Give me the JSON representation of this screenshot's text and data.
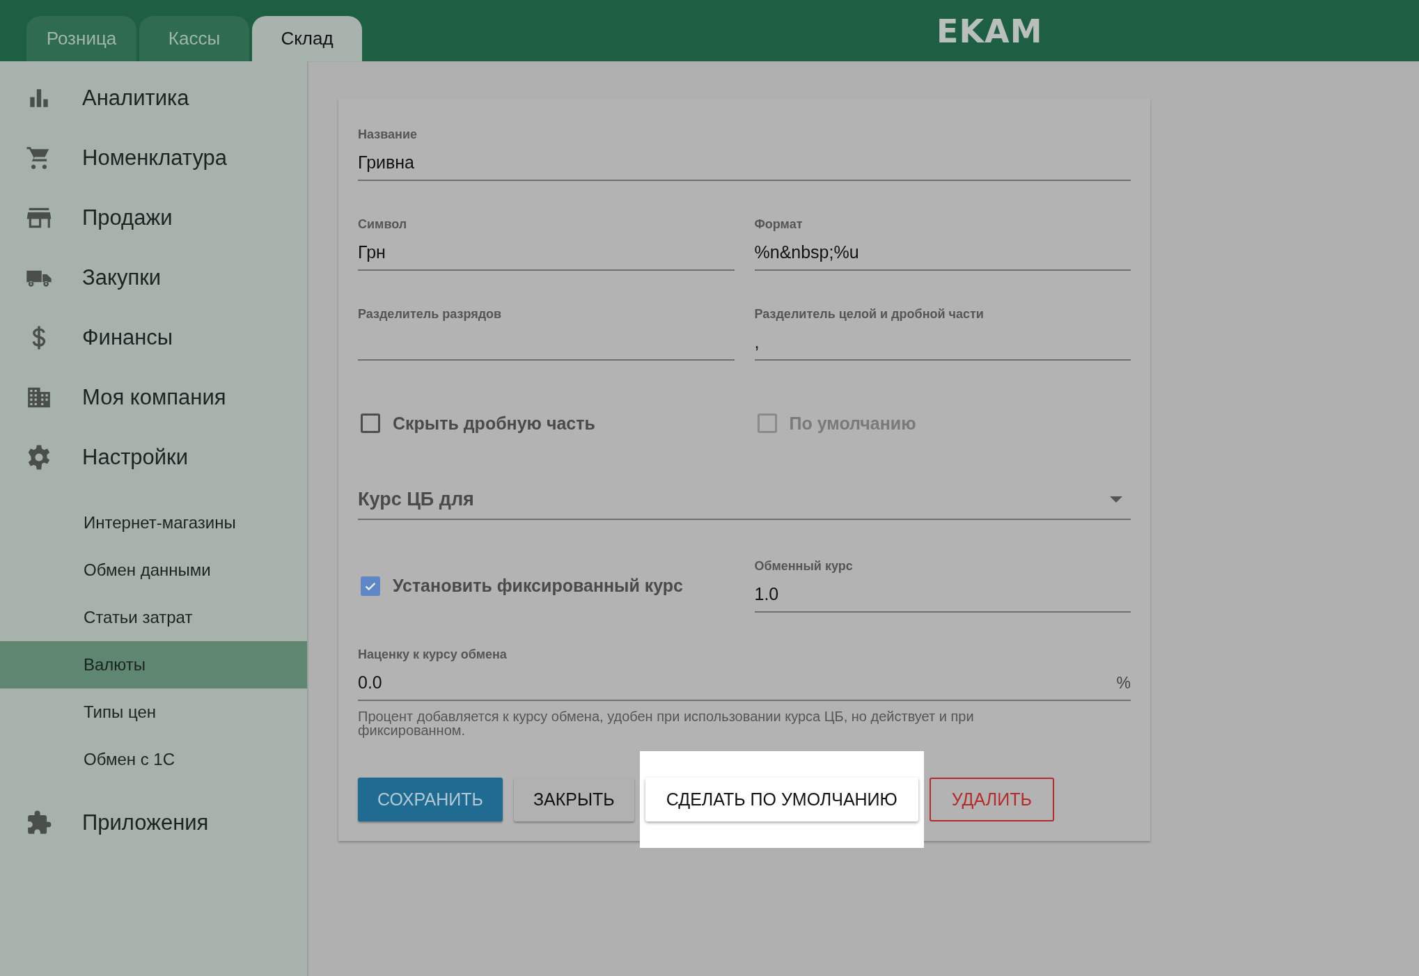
{
  "top_tabs": [
    {
      "label": "Розница",
      "selected": false
    },
    {
      "label": "Кассы",
      "selected": false
    },
    {
      "label": "Склад",
      "selected": true
    }
  ],
  "logo": "EKAM",
  "sidebar": {
    "items": [
      {
        "label": "Аналитика",
        "selected": false
      },
      {
        "label": "Номенклатура",
        "selected": false
      },
      {
        "label": "Продажи",
        "selected": false
      },
      {
        "label": "Закупки",
        "selected": false
      },
      {
        "label": "Финансы",
        "selected": false
      },
      {
        "label": "Моя компания",
        "selected": false
      },
      {
        "label": "Настройки",
        "selected": false,
        "children": [
          {
            "label": "Интернет-магазины",
            "selected": false
          },
          {
            "label": "Обмен данными",
            "selected": false
          },
          {
            "label": "Статьи затрат",
            "selected": false
          },
          {
            "label": "Валюты",
            "selected": true
          },
          {
            "label": "Типы цен",
            "selected": false
          },
          {
            "label": "Обмен с 1С",
            "selected": false
          }
        ]
      },
      {
        "label": "Приложения",
        "selected": false
      }
    ]
  },
  "form": {
    "name_field": {
      "label": "Название",
      "value": "Гривна"
    },
    "symbol_field": {
      "label": "Символ",
      "value": "Грн"
    },
    "format_field": {
      "label": "Формат",
      "value": "%n&nbsp;%u"
    },
    "group_separator_field": {
      "label": "Разделитель разрядов"
    },
    "decimal_separator_field": {
      "label": "Разделитель целой и дробной части",
      "value": ","
    },
    "checkboxes": [
      {
        "label": "Скрыть дробную часть",
        "checked": false,
        "disabled": false
      },
      {
        "label": "По умолчанию",
        "checked": false,
        "disabled": true
      }
    ],
    "cb_rate_select": {
      "label": "Курс ЦБ для"
    },
    "fixed_rate_checkbox": {
      "label": "Установить фиксированный курс",
      "checked": true
    },
    "exchange_rate_field": {
      "label": "Обменный курс",
      "value": "1.0"
    },
    "markup_field": {
      "label": "Наценку к курсу обмена",
      "value": "0.0",
      "suffix": "%",
      "helper": "Процент добавляется к курсу обмена, удобен при использовании курса ЦБ, но действует и при фиксированном."
    },
    "buttons": [
      {
        "label": "СОХРАНИТЬ",
        "kind": "primary"
      },
      {
        "label": "ЗАКРЫТЬ",
        "kind": "default"
      },
      {
        "label": "СДЕЛАТЬ ПО УМОЛЧАНИЮ",
        "kind": "highlighted"
      },
      {
        "label": "УДАЛИТЬ",
        "kind": "danger"
      }
    ]
  }
}
